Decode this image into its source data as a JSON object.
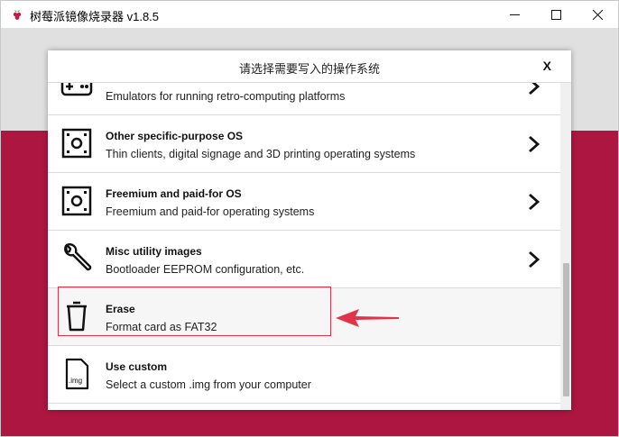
{
  "window": {
    "title": "树莓派镜像烧录器 v1.8.5",
    "app_icon": "raspberry-pi-icon",
    "controls": [
      "minimize-icon",
      "maximize-icon",
      "close-icon"
    ]
  },
  "dialog": {
    "title": "请选择需要写入的操作系统",
    "close_label": "X"
  },
  "items": [
    {
      "name": "",
      "desc": "Emulators for running retro-computing platforms",
      "icon": "gamepad-icon",
      "has_chevron": true
    },
    {
      "name": "Other specific-purpose OS",
      "desc": "Thin clients, digital signage and 3D printing operating systems",
      "icon": "os-chip-icon",
      "has_chevron": true
    },
    {
      "name": "Freemium and paid-for OS",
      "desc": "Freemium and paid-for operating systems",
      "icon": "os-chip-icon",
      "has_chevron": true
    },
    {
      "name": "Misc utility images",
      "desc": "Bootloader EEPROM configuration, etc.",
      "icon": "wrench-icon",
      "has_chevron": true
    },
    {
      "name": "Erase",
      "desc": "Format card as FAT32",
      "icon": "trash-icon",
      "has_chevron": false
    },
    {
      "name": "Use custom",
      "desc": "Select a custom .img from your computer",
      "icon": "img-file-icon",
      "icon_text": ".img",
      "has_chevron": false
    }
  ],
  "colors": {
    "app_background": "#c51a4a",
    "highlight_box": "#e0344b",
    "arrow": "#e0344b"
  },
  "annotation": {
    "highlighted_item": "Erase",
    "arrow": "red-arrow-pointing-left"
  }
}
